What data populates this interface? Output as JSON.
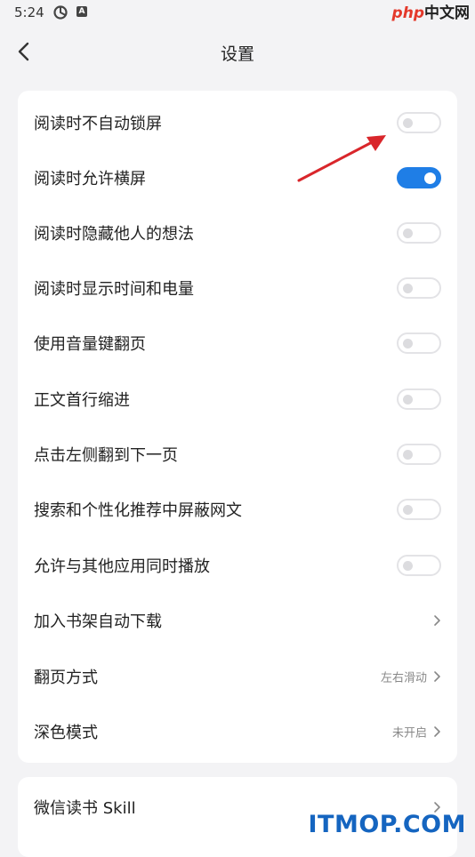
{
  "status_bar": {
    "time": "5:24",
    "icons": [
      "sync-icon",
      "a-badge-icon"
    ]
  },
  "watermark": {
    "top_part1": "php",
    "top_part2": "中文网",
    "bottom": "ITMOP.COM"
  },
  "header": {
    "title": "设置",
    "back_icon": "back-arrow-icon"
  },
  "settings": {
    "rows": [
      {
        "label": "阅读时不自动锁屏",
        "control": "toggle",
        "on": false
      },
      {
        "label": "阅读时允许横屏",
        "control": "toggle",
        "on": true
      },
      {
        "label": "阅读时隐藏他人的想法",
        "control": "toggle",
        "on": false
      },
      {
        "label": "阅读时显示时间和电量",
        "control": "toggle",
        "on": false
      },
      {
        "label": "使用音量键翻页",
        "control": "toggle",
        "on": false
      },
      {
        "label": "正文首行缩进",
        "control": "toggle",
        "on": false
      },
      {
        "label": "点击左侧翻到下一页",
        "control": "toggle",
        "on": false
      },
      {
        "label": "搜索和个性化推荐中屏蔽网文",
        "control": "toggle",
        "on": false
      },
      {
        "label": "允许与其他应用同时播放",
        "control": "toggle",
        "on": false
      },
      {
        "label": "加入书架自动下载",
        "control": "chevron",
        "value": ""
      },
      {
        "label": "翻页方式",
        "control": "chevron",
        "value": "左右滑动"
      },
      {
        "label": "深色模式",
        "control": "chevron",
        "value": "未开启"
      }
    ],
    "section2": [
      {
        "label": "微信读书 Skill",
        "control": "chevron"
      }
    ]
  },
  "colors": {
    "accent": "#1f7ee6",
    "annotation_arrow": "#d9262b",
    "background": "#f3f3f5"
  }
}
